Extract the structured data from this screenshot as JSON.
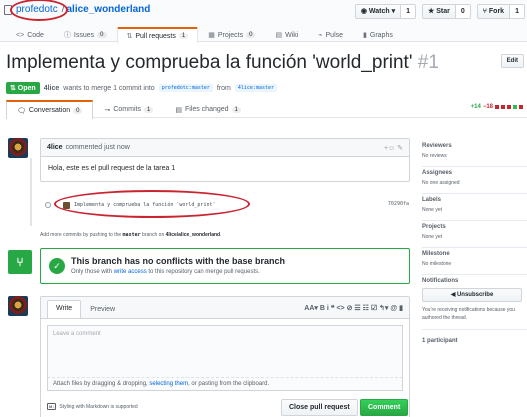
{
  "repo": {
    "owner": "profedotc",
    "separator": "/",
    "name": "alice_wonderland"
  },
  "actions": [
    {
      "label": "◉ Watch ▾",
      "count": "1"
    },
    {
      "label": "★ Star",
      "count": "0"
    },
    {
      "label": "⑂ Fork",
      "count": "1"
    }
  ],
  "nav": [
    {
      "icon": "<>",
      "label": "Code",
      "count": ""
    },
    {
      "icon": "ⓘ",
      "label": "Issues",
      "count": "0"
    },
    {
      "icon": "⇅",
      "label": "Pull requests",
      "count": "1"
    },
    {
      "icon": "▦",
      "label": "Projects",
      "count": "0"
    },
    {
      "icon": "▤",
      "label": "Wiki",
      "count": ""
    },
    {
      "icon": "⌁",
      "label": "Pulse",
      "count": ""
    },
    {
      "icon": "▮",
      "label": "Graphs",
      "count": ""
    }
  ],
  "pr": {
    "title": "Implementa y comprueba la función 'world_print'",
    "number": "#1",
    "edit_label": "Edit",
    "state": "⇅ Open",
    "author": "4lice",
    "meta_text": "wants to merge 1 commit into",
    "base_branch": "profedotc:master",
    "from_text": "from",
    "head_branch": "4lice:master"
  },
  "tabs": [
    {
      "icon": "🗨",
      "label": "Conversation",
      "count": "0"
    },
    {
      "icon": "⊸",
      "label": "Commits",
      "count": "1"
    },
    {
      "icon": "▤",
      "label": "Files changed",
      "count": "1"
    }
  ],
  "diffstat": {
    "plus": "+14",
    "minus": "−18"
  },
  "comment": {
    "author": "4lice",
    "action": "commented just now",
    "body": "Hola, este es el pull request de la tarea 1",
    "actions_icons": "+☺ ✎"
  },
  "commit": {
    "message": "Implementa y comprueba la función 'world_print'",
    "sha": "70290fa"
  },
  "push_note": {
    "prefix": "Add more commits by pushing to the",
    "branch": "master",
    "middle": "branch on",
    "repo": "4lice/alice_wonderland",
    "suffix": "."
  },
  "merge": {
    "title": "This branch has no conflicts with the base branch",
    "sub_prefix": "Only those with",
    "sub_link": "write access",
    "sub_suffix": "to this repository can merge pull requests."
  },
  "composer": {
    "tab_write": "Write",
    "tab_preview": "Preview",
    "toolbar": "AA▾  B  i     ❝  <>  ⊘     ☰  ☷  ☑     ↰▾  @  ▮",
    "placeholder": "Leave a comment",
    "attach_prefix": "Attach files by dragging & dropping,",
    "attach_link": "selecting them",
    "attach_suffix": ", or pasting from the clipboard.",
    "md_icon": "M↓",
    "md_note": "Styling with Markdown is supported",
    "close_label": "Close pull request",
    "comment_label": "Comment"
  },
  "sidebar": [
    {
      "title": "Reviewers",
      "value": "No reviews"
    },
    {
      "title": "Assignees",
      "value": "No one assigned"
    },
    {
      "title": "Labels",
      "value": "None yet"
    },
    {
      "title": "Projects",
      "value": "None yet"
    },
    {
      "title": "Milestone",
      "value": "No milestone"
    }
  ],
  "notifications": {
    "title": "Notifications",
    "button": "◀ Unsubscribe",
    "note": "You’re receiving notifications because you authored the thread."
  },
  "participants": "1 participant"
}
